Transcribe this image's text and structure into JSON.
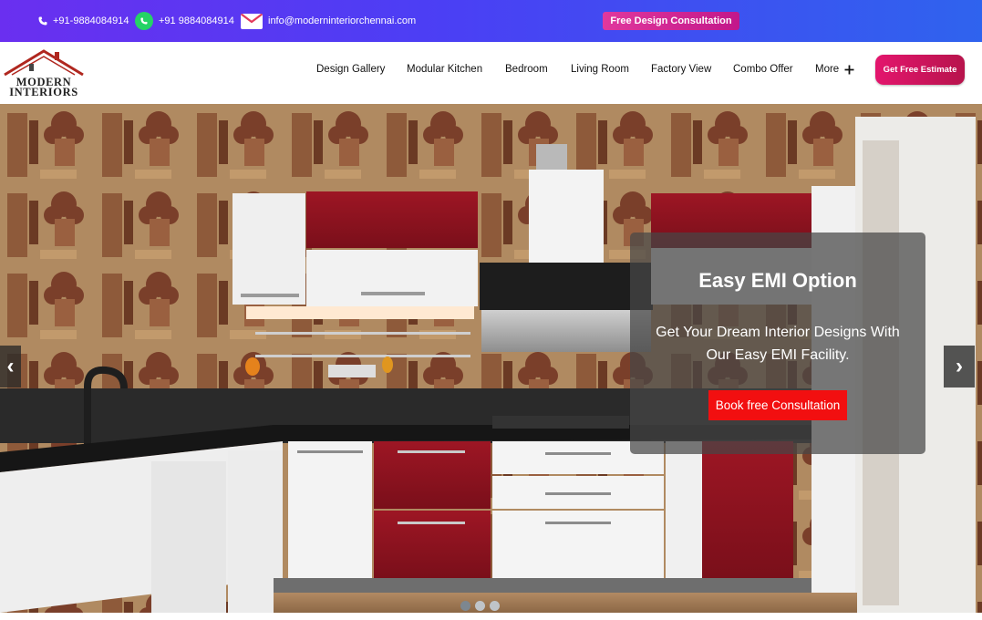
{
  "topbar": {
    "phone": "+91-9884084914",
    "whatsapp": "+91 9884084914",
    "email": "info@moderninteriorchennai.com",
    "cta_label": "Free Design Consultation"
  },
  "logo": {
    "line1": "MODERN",
    "line2": "INTERIORS"
  },
  "nav": {
    "items": [
      {
        "label": "Design Gallery"
      },
      {
        "label": "Modular Kitchen"
      },
      {
        "label": "Bedroom"
      },
      {
        "label": "Living Room"
      },
      {
        "label": "Factory View"
      },
      {
        "label": "Combo Offer"
      },
      {
        "label": "More"
      }
    ],
    "estimate_label": "Get Free Estimate"
  },
  "hero": {
    "title": "Easy EMI Option",
    "subtitle": "Get Your Dream Interior Designs With Our Easy EMI Facility.",
    "button_label": "Book free Consultation",
    "prev_label": "‹",
    "next_label": "›",
    "slides": 3,
    "active_slide": 1
  },
  "colors": {
    "topbar_start": "#6a2ff0",
    "topbar_end": "#2f63ee",
    "cta_pink": "#e0389d",
    "estimate_red": "#e3156d",
    "book_red": "#f20f10"
  }
}
